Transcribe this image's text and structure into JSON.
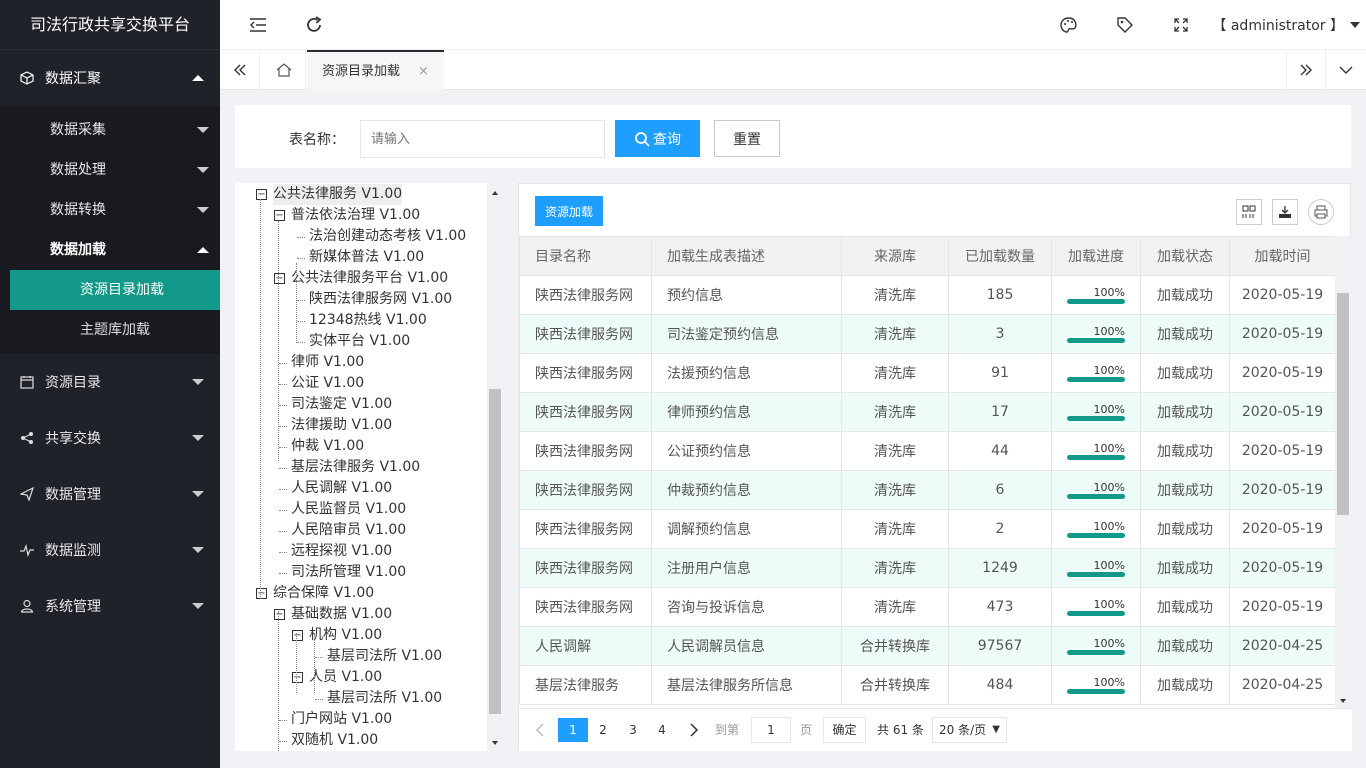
{
  "app": {
    "title": "司法行政共享交换平台"
  },
  "sidebar": {
    "group1": {
      "label": "数据汇聚"
    },
    "sub": [
      "数据采集",
      "数据处理",
      "数据转换",
      "数据加载"
    ],
    "sub2": [
      "资源目录加载",
      "主题库加载"
    ],
    "groups": [
      "资源目录",
      "共享交换",
      "数据管理",
      "数据监测",
      "系统管理"
    ]
  },
  "topbar": {
    "user": "【 administrator 】"
  },
  "tabs": {
    "active": "资源目录加载",
    "close": "×"
  },
  "search": {
    "label": "表名称：",
    "placeholder": "请输入",
    "query": "查询",
    "reset": "重置"
  },
  "tree": [
    {
      "label": "公共法律服务 V1.00",
      "level": 0,
      "toggle": "−",
      "selected": true
    },
    {
      "label": "普法依法治理 V1.00",
      "level": 1,
      "toggle": "−"
    },
    {
      "label": "法治创建动态考核 V1.00",
      "level": 2
    },
    {
      "label": "新媒体普法 V1.00",
      "level": 2
    },
    {
      "label": "公共法律服务平台 V1.00",
      "level": 1,
      "toggle": "−"
    },
    {
      "label": "陕西法律服务网 V1.00",
      "level": 2
    },
    {
      "label": "12348热线 V1.00",
      "level": 2
    },
    {
      "label": "实体平台 V1.00",
      "level": 2
    },
    {
      "label": "律师 V1.00",
      "level": 1
    },
    {
      "label": "公证 V1.00",
      "level": 1
    },
    {
      "label": "司法鉴定 V1.00",
      "level": 1
    },
    {
      "label": "法律援助 V1.00",
      "level": 1
    },
    {
      "label": "仲裁 V1.00",
      "level": 1
    },
    {
      "label": "基层法律服务 V1.00",
      "level": 1
    },
    {
      "label": "人民调解 V1.00",
      "level": 1
    },
    {
      "label": "人民监督员 V1.00",
      "level": 1
    },
    {
      "label": "人民陪审员 V1.00",
      "level": 1
    },
    {
      "label": "远程探视 V1.00",
      "level": 1
    },
    {
      "label": "司法所管理 V1.00",
      "level": 1
    },
    {
      "label": "综合保障 V1.00",
      "level": 0,
      "toggle": "−"
    },
    {
      "label": "基础数据 V1.00",
      "level": 1,
      "toggle": "−"
    },
    {
      "label": "机构 V1.00",
      "level": 2,
      "toggle": "−"
    },
    {
      "label": "基层司法所 V1.00",
      "level": 3
    },
    {
      "label": "人员 V1.00",
      "level": 2,
      "toggle": "−"
    },
    {
      "label": "基层司法所 V1.00",
      "level": 3
    },
    {
      "label": "门户网站 V1.00",
      "level": 1
    },
    {
      "label": "双随机 V1.00",
      "level": 1
    }
  ],
  "panel": {
    "load_button": "资源加载"
  },
  "table": {
    "headers": [
      "目录名称",
      "加载生成表描述",
      "来源库",
      "已加载数量",
      "加载进度",
      "加载状态",
      "加载时间"
    ],
    "rows": [
      [
        "陕西法律服务网",
        "预约信息",
        "清洗库",
        "185",
        "100%",
        "加载成功",
        "2020-05-19"
      ],
      [
        "陕西法律服务网",
        "司法鉴定预约信息",
        "清洗库",
        "3",
        "100%",
        "加载成功",
        "2020-05-19"
      ],
      [
        "陕西法律服务网",
        "法援预约信息",
        "清洗库",
        "91",
        "100%",
        "加载成功",
        "2020-05-19"
      ],
      [
        "陕西法律服务网",
        "律师预约信息",
        "清洗库",
        "17",
        "100%",
        "加载成功",
        "2020-05-19"
      ],
      [
        "陕西法律服务网",
        "公证预约信息",
        "清洗库",
        "44",
        "100%",
        "加载成功",
        "2020-05-19"
      ],
      [
        "陕西法律服务网",
        "仲裁预约信息",
        "清洗库",
        "6",
        "100%",
        "加载成功",
        "2020-05-19"
      ],
      [
        "陕西法律服务网",
        "调解预约信息",
        "清洗库",
        "2",
        "100%",
        "加载成功",
        "2020-05-19"
      ],
      [
        "陕西法律服务网",
        "注册用户信息",
        "清洗库",
        "1249",
        "100%",
        "加载成功",
        "2020-05-19"
      ],
      [
        "陕西法律服务网",
        "咨询与投诉信息",
        "清洗库",
        "473",
        "100%",
        "加载成功",
        "2020-05-19"
      ],
      [
        "人民调解",
        "人民调解员信息",
        "合并转换库",
        "97567",
        "100%",
        "加载成功",
        "2020-04-25"
      ],
      [
        "基层法律服务",
        "基层法律服务所信息",
        "合并转换库",
        "484",
        "100%",
        "加载成功",
        "2020-04-25"
      ]
    ]
  },
  "pager": {
    "pages": [
      "1",
      "2",
      "3",
      "4"
    ],
    "goto": "到第",
    "goto_value": "1",
    "page_unit": "页",
    "confirm": "确定",
    "total": "共 61 条",
    "per_page": "20 条/页"
  },
  "colors": {
    "sidebar": "#20222a",
    "active": "#129989",
    "primary": "#1e9fff",
    "row_alt": "#eefcf9"
  }
}
